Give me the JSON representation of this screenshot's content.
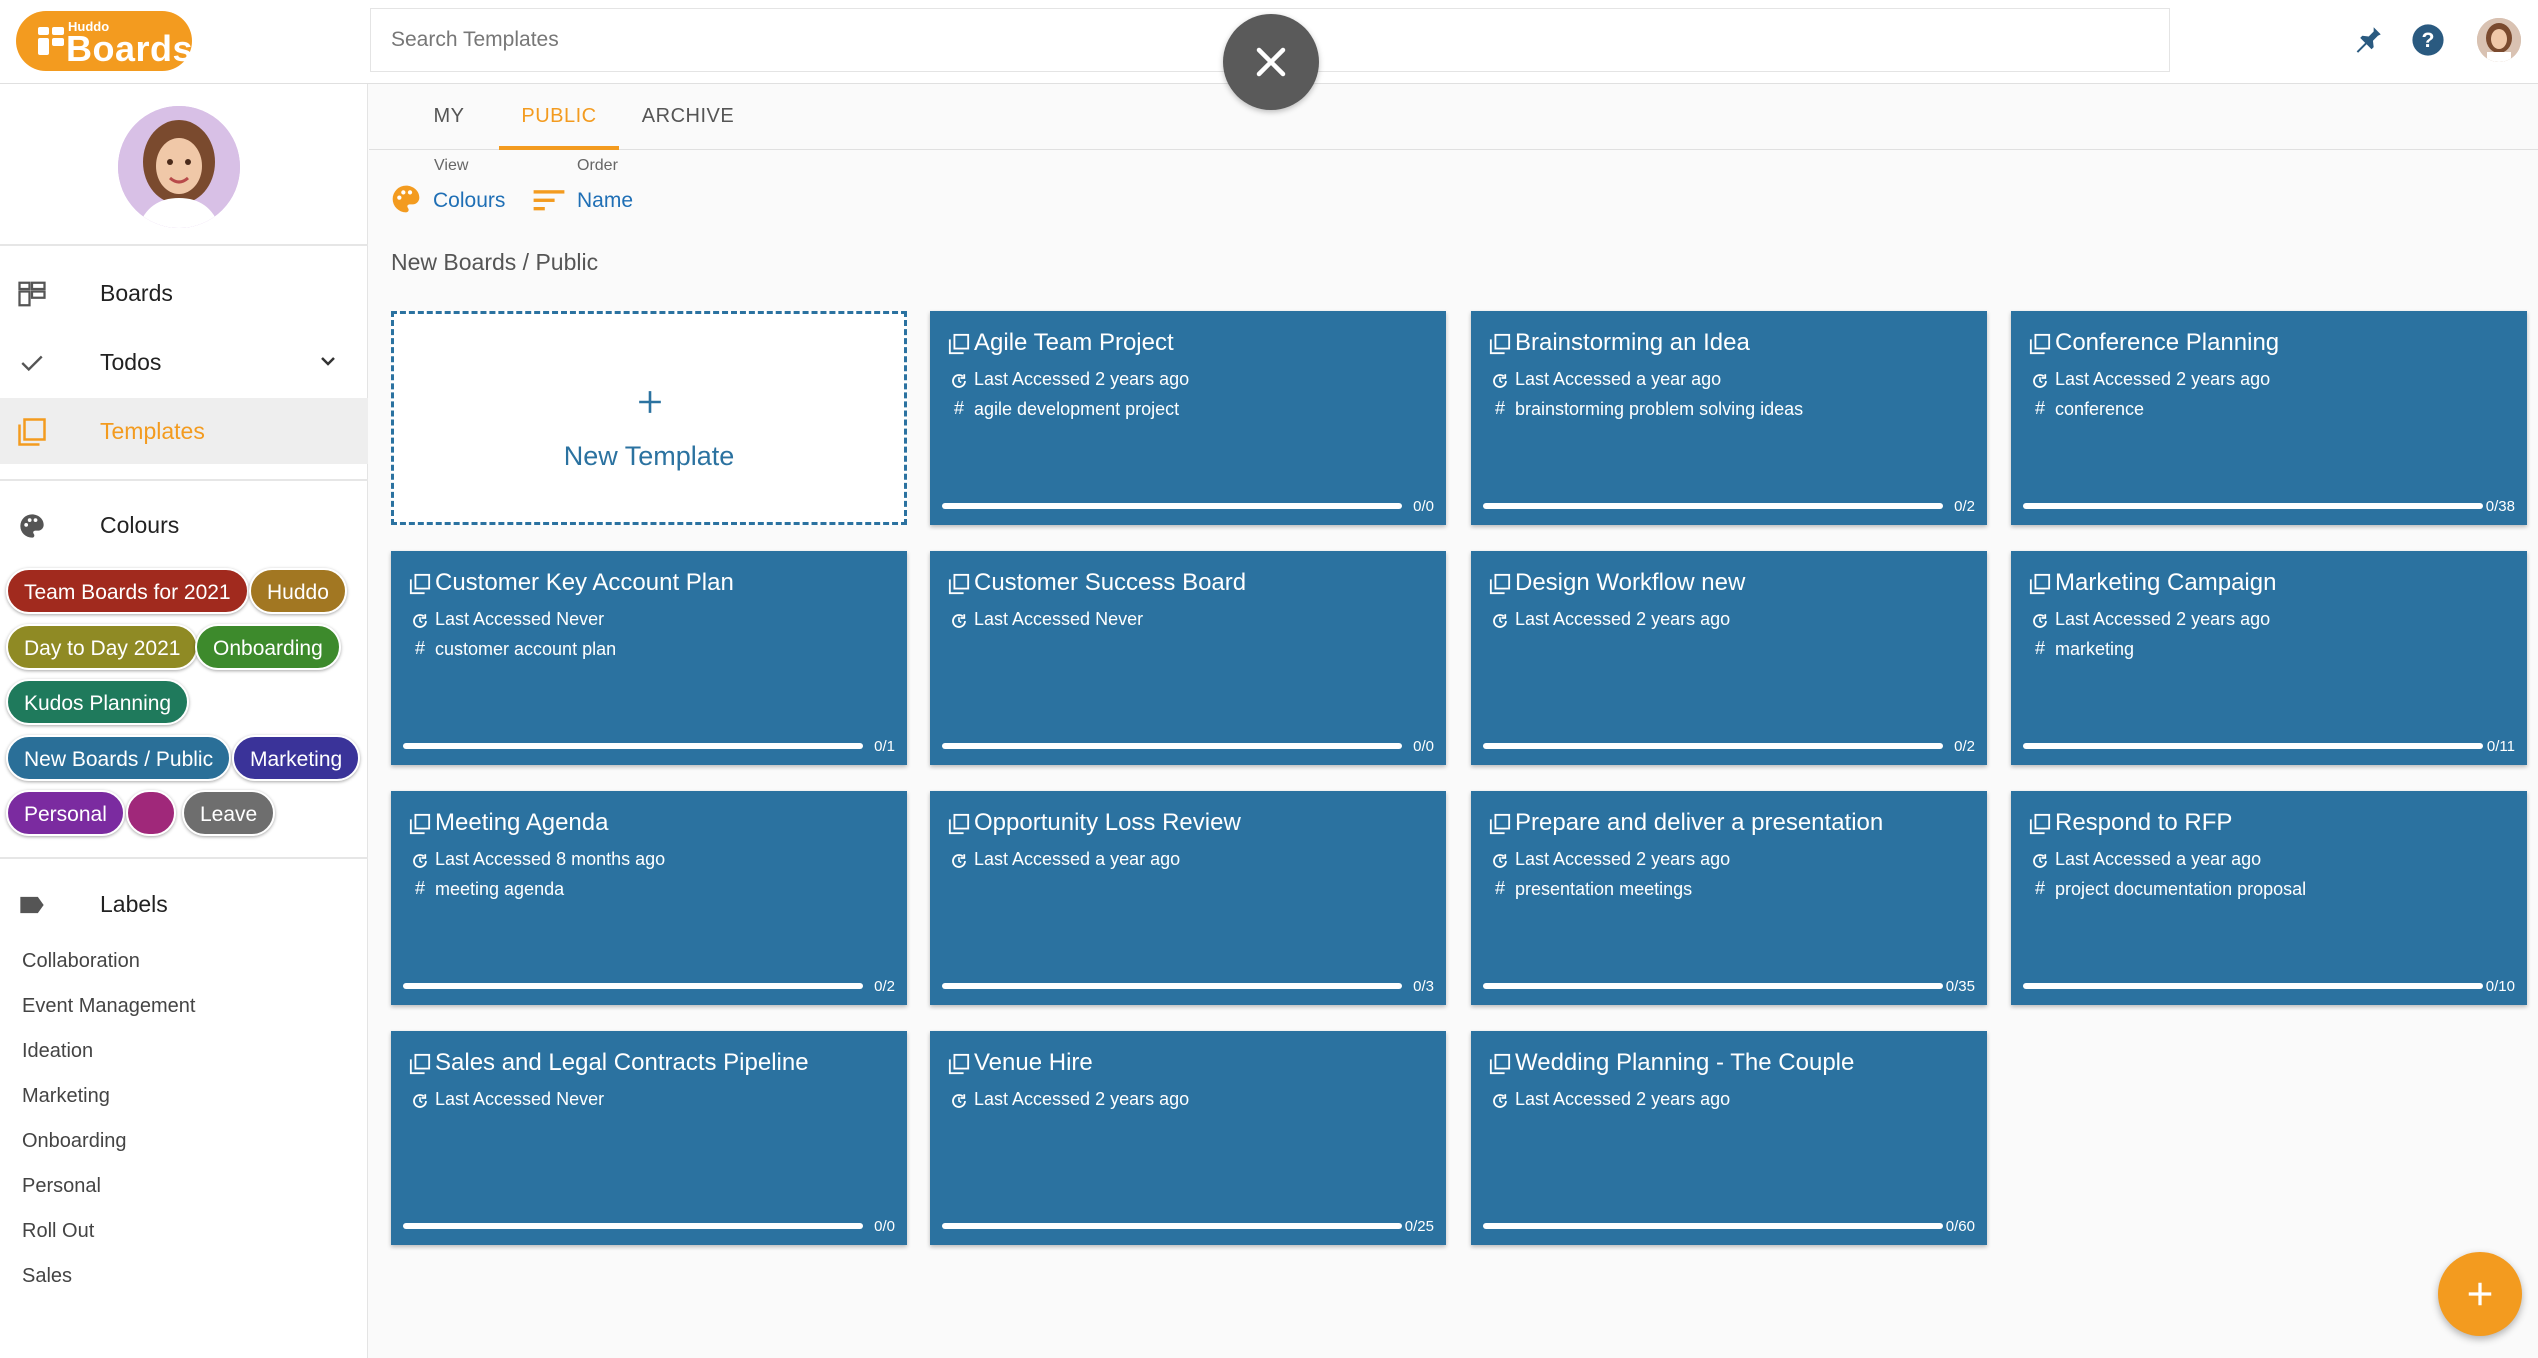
{
  "app": {
    "logo_small": "Huddo",
    "logo_big": "Boards",
    "brand_color": "#f39b1f",
    "card_color": "#2b72a0"
  },
  "search": {
    "placeholder": "Search Templates"
  },
  "top_icons": [
    "pin-icon",
    "help-icon",
    "user-avatar"
  ],
  "sidebar": {
    "nav": [
      {
        "label": "Boards",
        "icon": "boards-grid-icon"
      },
      {
        "label": "Todos",
        "icon": "check-icon"
      },
      {
        "label": "Templates",
        "icon": "templates-icon"
      }
    ],
    "colours_title": "Colours",
    "chips": [
      {
        "label": "Team Boards for 2021",
        "color": "#a12a1e"
      },
      {
        "label": "Huddo",
        "color": "#a27722"
      },
      {
        "label": "Day to Day 2021",
        "color": "#8f8a24"
      },
      {
        "label": "Onboarding",
        "color": "#3d8a2c"
      },
      {
        "label": "Kudos Planning",
        "color": "#1f7a5c"
      },
      {
        "label": "New Boards / Public",
        "color": "#2a6f98"
      },
      {
        "label": "Marketing",
        "color": "#3a3399"
      },
      {
        "label": "Personal",
        "color": "#7b2ba0"
      },
      {
        "label": "",
        "color": "#a0287a"
      },
      {
        "label": "Leave",
        "color": "#6e6e6e"
      }
    ],
    "labels_title": "Labels",
    "labels": [
      "Collaboration",
      "Event Management",
      "Ideation",
      "Marketing",
      "Onboarding",
      "Personal",
      "Roll Out",
      "Sales"
    ]
  },
  "tabs": [
    "MY",
    "PUBLIC",
    "ARCHIVE"
  ],
  "active_tab": "PUBLIC",
  "view": {
    "label": "View",
    "value": "Colours"
  },
  "order": {
    "label": "Order",
    "value": "Name"
  },
  "breadcrumb": "New Boards / Public",
  "new_template_label": "New Template",
  "cards": [
    {
      "title": "Agile Team Project",
      "accessed": "Last Accessed 2 years ago",
      "tags": "agile development project",
      "progress": "0/0"
    },
    {
      "title": "Brainstorming an Idea",
      "accessed": "Last Accessed a year ago",
      "tags": "brainstorming problem solving ideas",
      "progress": "0/2"
    },
    {
      "title": "Conference Planning",
      "accessed": "Last Accessed 2 years ago",
      "tags": "conference",
      "progress": "0/38"
    },
    {
      "title": "Customer Key Account Plan",
      "accessed": "Last Accessed Never",
      "tags": "customer account plan",
      "progress": "0/1"
    },
    {
      "title": "Customer Success Board",
      "accessed": "Last Accessed Never",
      "tags": "",
      "progress": "0/0"
    },
    {
      "title": "Design Workflow new",
      "accessed": "Last Accessed 2 years ago",
      "tags": "",
      "progress": "0/2"
    },
    {
      "title": "Marketing Campaign",
      "accessed": "Last Accessed 2 years ago",
      "tags": "marketing",
      "progress": "0/11"
    },
    {
      "title": "Meeting Agenda",
      "accessed": "Last Accessed 8 months ago",
      "tags": "meeting agenda",
      "progress": "0/2"
    },
    {
      "title": "Opportunity Loss Review",
      "accessed": "Last Accessed a year ago",
      "tags": "",
      "progress": "0/3"
    },
    {
      "title": "Prepare and deliver a presentation",
      "accessed": "Last Accessed 2 years ago",
      "tags": "presentation meetings",
      "progress": "0/35"
    },
    {
      "title": "Respond to RFP",
      "accessed": "Last Accessed a year ago",
      "tags": "project documentation proposal",
      "progress": "0/10"
    },
    {
      "title": "Sales and Legal Contracts Pipeline",
      "accessed": "Last Accessed Never",
      "tags": "",
      "progress": "0/0"
    },
    {
      "title": "Venue Hire",
      "accessed": "Last Accessed 2 years ago",
      "tags": "",
      "progress": "0/25"
    },
    {
      "title": "Wedding Planning - The Couple",
      "accessed": "Last Accessed 2 years ago",
      "tags": "",
      "progress": "0/60"
    }
  ]
}
